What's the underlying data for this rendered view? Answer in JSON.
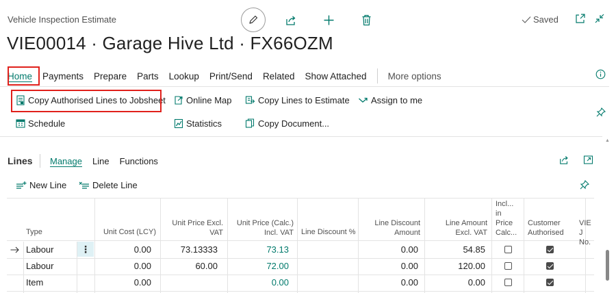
{
  "page": {
    "type": "Vehicle Inspection Estimate",
    "title": "VIE00014 · Garage Hive Ltd · FX66OZM",
    "status": "Saved"
  },
  "menu": [
    "Home",
    "Payments",
    "Prepare",
    "Parts",
    "Lookup",
    "Print/Send",
    "Related",
    "Show Attached"
  ],
  "more_options": "More options",
  "actions": {
    "copy_authorised": "Copy Authorised Lines to Jobsheet",
    "online_map": "Online Map",
    "copy_lines_to_estimate": "Copy Lines to Estimate",
    "assign_to_me": "Assign to me",
    "schedule": "Schedule",
    "statistics": "Statistics",
    "copy_document": "Copy Document..."
  },
  "lines": {
    "title": "Lines",
    "tabs": [
      "Manage",
      "Line",
      "Functions"
    ],
    "new_line": "New Line",
    "delete_line": "Delete Line",
    "headers": {
      "type": "Type",
      "unit_cost": "Unit Cost (LCY)",
      "unit_price_excl": [
        "Unit Price Excl.",
        "VAT"
      ],
      "unit_price_calc": [
        "Unit Price (Calc.)",
        "Incl. VAT"
      ],
      "line_discount_pct": "Line Discount %",
      "line_discount_amount": [
        "Line Discount",
        "Amount"
      ],
      "line_amount_excl": [
        "Line Amount",
        "Excl. VAT"
      ],
      "incl_in_price": [
        "Incl...",
        "in",
        "Price",
        "Calc..."
      ],
      "customer_authorised": [
        "Customer",
        "Authorised"
      ],
      "vie_no": [
        "VIE J",
        "No."
      ]
    },
    "rows": [
      {
        "type": "Labour",
        "unit_cost": "0.00",
        "unit_price_excl": "73.13333",
        "unit_price_calc": "73.13",
        "line_discount_amount": "0.00",
        "line_amount_excl": "54.85",
        "incl_in_price": false,
        "customer_authorised": true,
        "current": true
      },
      {
        "type": "Labour",
        "unit_cost": "0.00",
        "unit_price_excl": "60.00",
        "unit_price_calc": "72.00",
        "line_discount_amount": "0.00",
        "line_amount_excl": "120.00",
        "incl_in_price": false,
        "customer_authorised": true,
        "current": false
      },
      {
        "type": "Item",
        "unit_cost": "0.00",
        "unit_price_excl": "",
        "unit_price_calc": "0.00",
        "line_discount_amount": "0.00",
        "line_amount_excl": "0.00",
        "incl_in_price": false,
        "customer_authorised": true,
        "current": false
      }
    ]
  },
  "colors": {
    "accent": "#00796b",
    "highlight_box": "#e0201b",
    "selected_cell": "#dff1f5"
  },
  "icons": [
    "edit-icon",
    "share-icon",
    "add-icon",
    "delete-icon",
    "check-icon",
    "open-new-window-icon",
    "collapse-icon",
    "info-icon",
    "pin-icon",
    "filter-icon",
    "expand-icon",
    "row-arrow-icon",
    "more-icon"
  ]
}
